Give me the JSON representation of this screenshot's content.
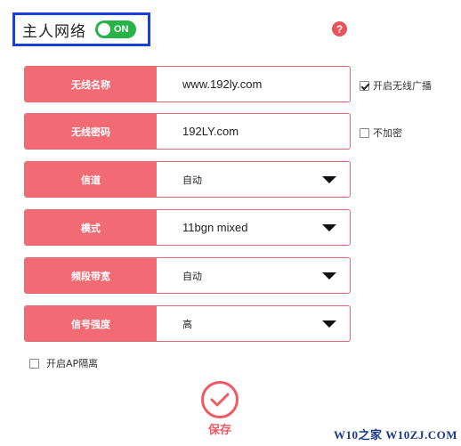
{
  "header": {
    "title": "主人网络",
    "toggle_label": "ON",
    "toggle_color": "#28b34a",
    "help_glyph": "?"
  },
  "rows": [
    {
      "label": "无线名称",
      "value": "www.192ly.com",
      "kind": "text"
    },
    {
      "label": "无线密码",
      "value": "192LY.com",
      "kind": "text"
    },
    {
      "label": "信道",
      "value": "自动",
      "kind": "select"
    },
    {
      "label": "模式",
      "value": "11bgn mixed",
      "kind": "select"
    },
    {
      "label": "频段带宽",
      "value": "自动",
      "kind": "select"
    },
    {
      "label": "信号强度",
      "value": "高",
      "kind": "select"
    }
  ],
  "checks": {
    "broadcast": {
      "label": "开启无线广播",
      "checked": true
    },
    "no_encrypt": {
      "label": "不加密",
      "checked": false
    },
    "ap_isolation": {
      "label": "开启AP隔离",
      "checked": false
    }
  },
  "save": {
    "label": "保存"
  },
  "watermark": "W10之家 W10ZJ.COM",
  "colors": {
    "accent": "#f26b74",
    "header_border": "#1a3fd6"
  }
}
